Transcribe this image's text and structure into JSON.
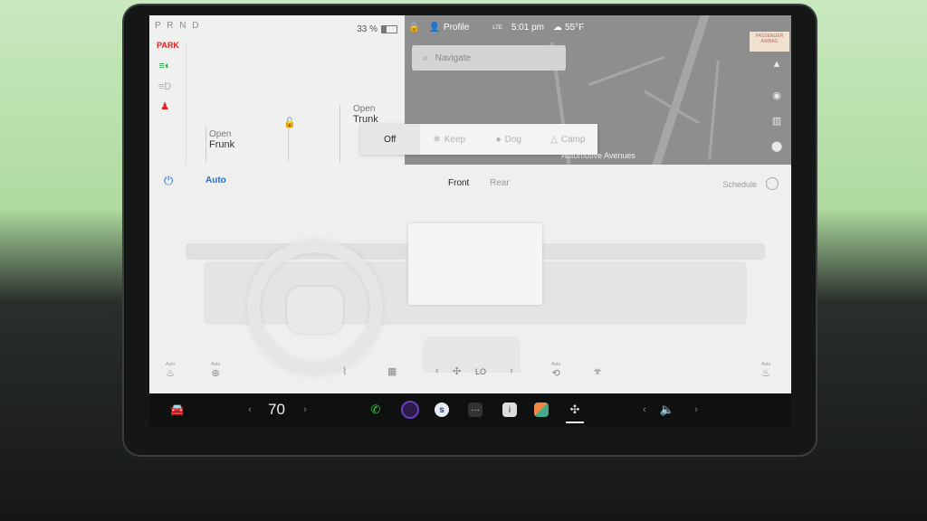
{
  "status": {
    "gear": "P R N D",
    "park": "PARK",
    "battery_percent": "33 %",
    "battery_level": 0.33
  },
  "car_panel": {
    "frunk_open_label": "Open",
    "frunk_label": "Frunk",
    "trunk_open_label": "Open",
    "trunk_label": "Trunk"
  },
  "topbar": {
    "profile": "Profile",
    "signal": "LTE",
    "time": "5:01 pm",
    "temperature": "55°F"
  },
  "map": {
    "search_placeholder": "Navigate",
    "poi_label": "Automotive Avenues",
    "airbag_label": "PASSENGER AIRBAG"
  },
  "climate_mode": {
    "options": [
      "Off",
      "Keep",
      "Dog",
      "Camp"
    ],
    "selected": "Off"
  },
  "climate": {
    "auto_label": "Auto",
    "tab_front": "Front",
    "tab_rear": "Rear",
    "schedule_label": "Schedule",
    "fan_level": "LO",
    "seat_left_auto": "Auto",
    "wheel_heat_auto": "Auto",
    "seat_right_auto": "Auto"
  },
  "taskbar": {
    "temperature_setting": "70"
  },
  "colors": {
    "accent": "#1e6fd9",
    "park": "#d22222",
    "phone": "#2ecc40"
  }
}
